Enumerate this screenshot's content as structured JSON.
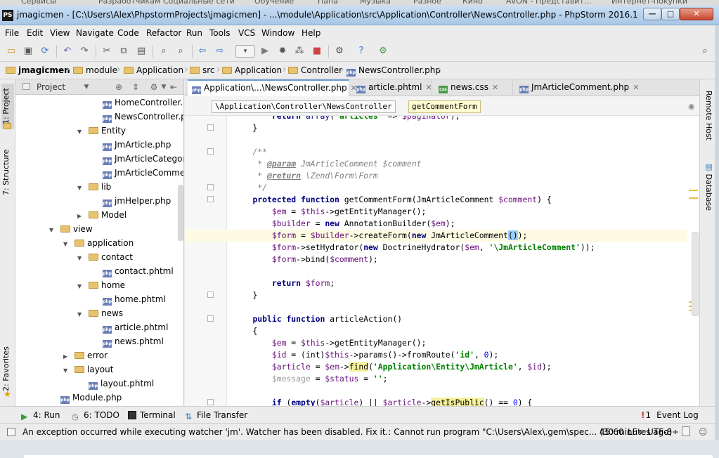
{
  "bookmarks": [
    "Сервисы",
    "Разработчикам",
    "Социальные сети",
    "Обучение",
    "Папа",
    "Музыка",
    "Разное",
    "Кино",
    "AVON - Представит...",
    "Интернет-покупки"
  ],
  "window": {
    "app_icon": "PS",
    "title": "jmagicmen - [C:\\Users\\Alex\\PhpstormProjects\\jmagicmen] - ...\\module\\Application\\src\\Application\\Controller\\NewsController.php - PhpStorm 2016.1",
    "min": "—",
    "max": "□",
    "close": "✕"
  },
  "menu": [
    "File",
    "Edit",
    "View",
    "Navigate",
    "Code",
    "Refactor",
    "Run",
    "Tools",
    "VCS",
    "Window",
    "Help"
  ],
  "toolbar": {
    "icons": [
      "open-icon",
      "save-icon",
      "sync-icon",
      "undo-icon",
      "redo-icon",
      "cut-icon",
      "copy-icon",
      "paste-icon",
      "find-icon",
      "replace-icon",
      "back-icon",
      "forward-icon",
      "run-config-dropdown",
      "run-icon",
      "debug-icon",
      "coverage-icon",
      "stop-icon",
      "settings-icon",
      "help-icon",
      "plugin-icon",
      "search-everywhere-icon"
    ],
    "dropdown": "▾"
  },
  "breadcrumbs": [
    "jmagicmen",
    "module",
    "Application",
    "src",
    "Application",
    "Controller",
    "NewsController.php"
  ],
  "left_tabs": [
    "1: Project",
    "7: Structure",
    "2: Favorites"
  ],
  "project": {
    "title": "Project",
    "tree": [
      {
        "label": "HomeController.php",
        "type": "php",
        "depth": 4
      },
      {
        "label": "NewsController.php",
        "type": "php",
        "depth": 4
      },
      {
        "label": "Entity",
        "type": "folder",
        "depth": 3,
        "open": true
      },
      {
        "label": "JmArticle.php",
        "type": "php",
        "depth": 4
      },
      {
        "label": "JmArticleCategory.php",
        "type": "php",
        "depth": 4
      },
      {
        "label": "JmArticleComment.php",
        "type": "php",
        "depth": 4
      },
      {
        "label": "lib",
        "type": "folder",
        "depth": 3,
        "open": true
      },
      {
        "label": "jmHelper.php",
        "type": "php",
        "depth": 4
      },
      {
        "label": "Model",
        "type": "folder",
        "depth": 3,
        "open": false
      },
      {
        "label": "view",
        "type": "folder",
        "depth": 1,
        "open": true
      },
      {
        "label": "application",
        "type": "folder",
        "depth": 2,
        "open": true
      },
      {
        "label": "contact",
        "type": "folder",
        "depth": 3,
        "open": true
      },
      {
        "label": "contact.phtml",
        "type": "phtml",
        "depth": 4
      },
      {
        "label": "home",
        "type": "folder",
        "depth": 3,
        "open": true
      },
      {
        "label": "home.phtml",
        "type": "phtml",
        "depth": 4
      },
      {
        "label": "news",
        "type": "folder",
        "depth": 3,
        "open": true
      },
      {
        "label": "article.phtml",
        "type": "php",
        "depth": 4
      },
      {
        "label": "news.phtml",
        "type": "php",
        "depth": 4
      },
      {
        "label": "error",
        "type": "folder",
        "depth": 2,
        "open": false
      },
      {
        "label": "layout",
        "type": "folder",
        "depth": 2,
        "open": true
      },
      {
        "label": "layout.phtml",
        "type": "php",
        "depth": 3
      },
      {
        "label": "Module.php",
        "type": "php",
        "depth": 1
      }
    ]
  },
  "editor_tabs": [
    {
      "label": "Application\\...\\NewsController.php",
      "type": "php",
      "active": true
    },
    {
      "label": "article.phtml",
      "type": "php",
      "active": false
    },
    {
      "label": "news.css",
      "type": "css",
      "active": false
    },
    {
      "label": "JmArticleComment.php",
      "type": "php",
      "active": false
    }
  ],
  "editor_crumb": {
    "namespace": "\\Application\\Controller\\NewsController",
    "method": "getCommentForm"
  },
  "right_tabs": [
    "Remote Host",
    "Database"
  ],
  "bottom_tools": [
    "4: Run",
    "6: TODO",
    "Terminal",
    "File Transfer",
    "Event Log"
  ],
  "event_log_count": "1",
  "status": {
    "message": "An exception occurred while executing watcher 'jm'. Watcher has been disabled. Fix it.: Cannot run program \"C:\\Users\\Alex\\.gem\\spec... (30 minutes ago)",
    "position": "45:60",
    "line_sep": "LF÷",
    "encoding": "UTF-8÷"
  }
}
